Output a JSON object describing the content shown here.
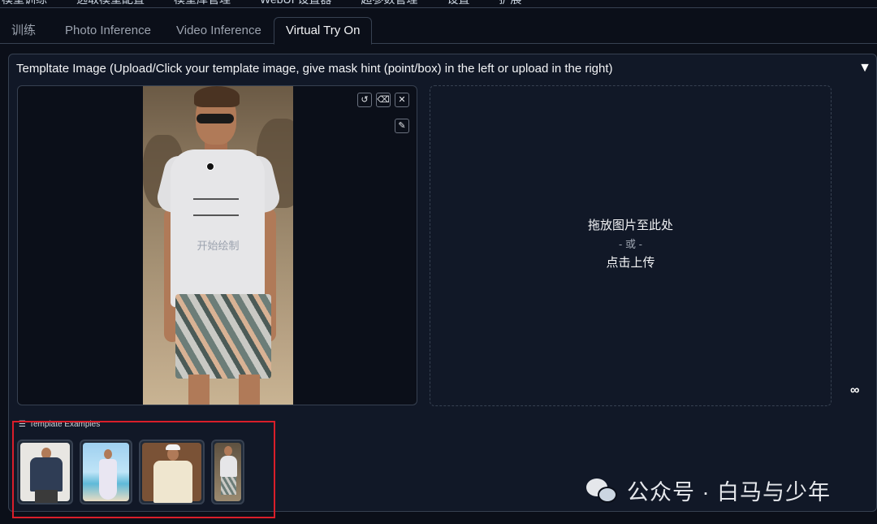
{
  "top_nav": [
    "模型训练",
    "选取模型配置",
    "模型库管理",
    "WebUI 设置器",
    "超参数管理",
    "设置",
    "扩展"
  ],
  "tabs": [
    {
      "label": "训练",
      "active": false
    },
    {
      "label": "Photo Inference",
      "active": false
    },
    {
      "label": "Video Inference",
      "active": false
    },
    {
      "label": "Virtual Try On",
      "active": true
    }
  ],
  "panel": {
    "title": "Templtate Image (Upload/Click your template image, give mask hint (point/box) in the left or upload in the right)",
    "collapse_icon": "▼"
  },
  "canvas": {
    "draw_hint": "开始绘制",
    "tools": {
      "undo": "↺",
      "eraser": "⌫",
      "clear": "✕",
      "brush": "✎"
    }
  },
  "upload": {
    "line1": "拖放图片至此处",
    "line2": "- 或 -",
    "line3": "点击上传"
  },
  "infinity_glyph": "∞",
  "examples": {
    "label": "Template Examples",
    "items": [
      {
        "name": "navy tee man"
      },
      {
        "name": "white dress woman beach"
      },
      {
        "name": "cream tee woman cap"
      },
      {
        "name": "white tee man shorts"
      }
    ]
  },
  "watermark": "公众号 · 白马与少年",
  "colors": {
    "bg": "#0b0f19",
    "panel": "#111827",
    "border": "#374151",
    "highlight": "#d91e2a"
  }
}
